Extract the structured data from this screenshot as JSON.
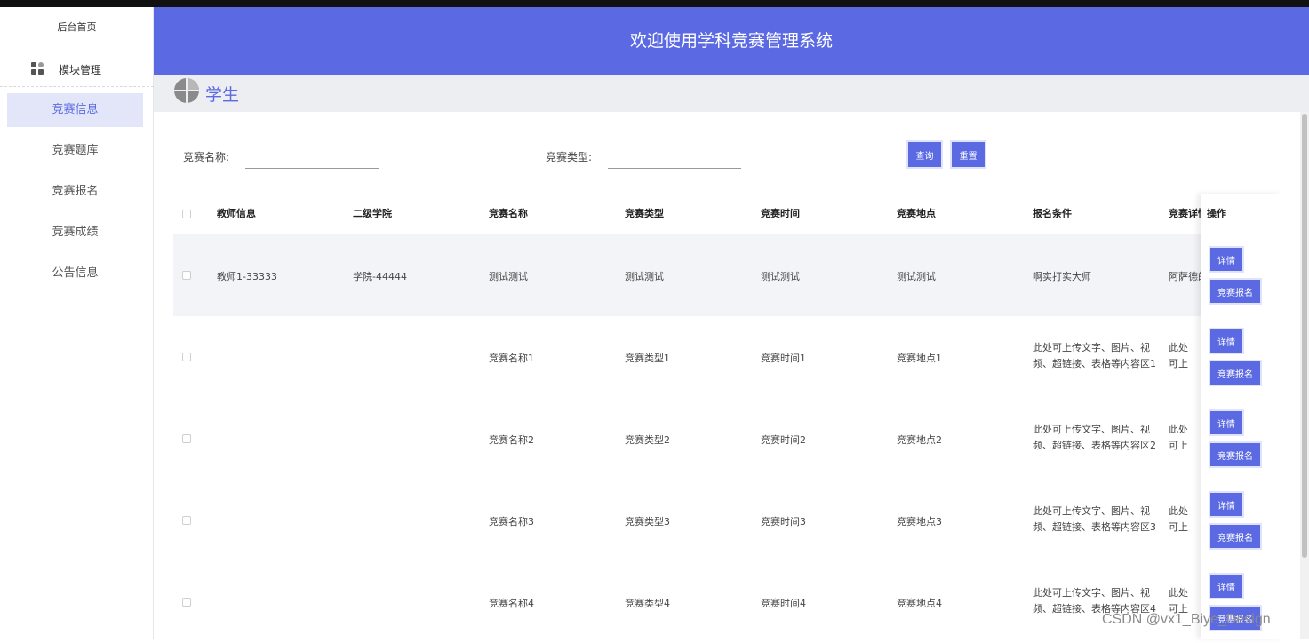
{
  "sidebar": {
    "home": "后台首页",
    "module": "模块管理",
    "items": [
      {
        "label": "竞赛信息"
      },
      {
        "label": "竞赛题库"
      },
      {
        "label": "竞赛报名"
      },
      {
        "label": "竞赛成绩"
      },
      {
        "label": "公告信息"
      }
    ]
  },
  "header": {
    "title": "欢迎使用学科竞赛管理系统"
  },
  "breadcrumb": {
    "label": "学生"
  },
  "search": {
    "name_label": "竞赛名称:",
    "type_label": "竞赛类型:",
    "name_value": "",
    "type_value": "",
    "query_label": "查询",
    "reset_label": "重置"
  },
  "table": {
    "headers": [
      "教师信息",
      "二级学院",
      "竞赛名称",
      "竞赛类型",
      "竞赛时间",
      "竞赛地点",
      "报名条件",
      "竞赛详情",
      "操作"
    ],
    "rows": [
      {
        "teacher": "教师1-33333",
        "college": "学院-44444",
        "name": "测试测试",
        "type": "测试测试",
        "time": "测试测试",
        "place": "测试测试",
        "cond": "啊实打实大师",
        "detail": "阿萨德的"
      },
      {
        "teacher": "",
        "college": "",
        "name": "竞赛名称1",
        "type": "竞赛类型1",
        "time": "竞赛时间1",
        "place": "竞赛地点1",
        "cond": "此处可上传文字、图片、视频、超链接、表格等内容区1",
        "detail": "此处可上传文字、图片、视频、超链接"
      },
      {
        "teacher": "",
        "college": "",
        "name": "竞赛名称2",
        "type": "竞赛类型2",
        "time": "竞赛时间2",
        "place": "竞赛地点2",
        "cond": "此处可上传文字、图片、视频、超链接、表格等内容区2",
        "detail": "此处可上传文字、图片、视频、超链接"
      },
      {
        "teacher": "",
        "college": "",
        "name": "竞赛名称3",
        "type": "竞赛类型3",
        "time": "竞赛时间3",
        "place": "竞赛地点3",
        "cond": "此处可上传文字、图片、视频、超链接、表格等内容区3",
        "detail": "此处可上传文字、图片、视频、超链接"
      },
      {
        "teacher": "",
        "college": "",
        "name": "竞赛名称4",
        "type": "竞赛类型4",
        "time": "竞赛时间4",
        "place": "竞赛地点4",
        "cond": "此处可上传文字、图片、视频、超链接、表格等内容区4",
        "detail": "此处可上传文字、图片、视频、超链接"
      }
    ],
    "detail_btn": "详情",
    "signup_btn": "竞赛报名"
  },
  "watermark": "CSDN @vx1_Biye_Design",
  "colors": {
    "primary": "#5b6ae3",
    "active_bg": "#e3e6f8"
  }
}
